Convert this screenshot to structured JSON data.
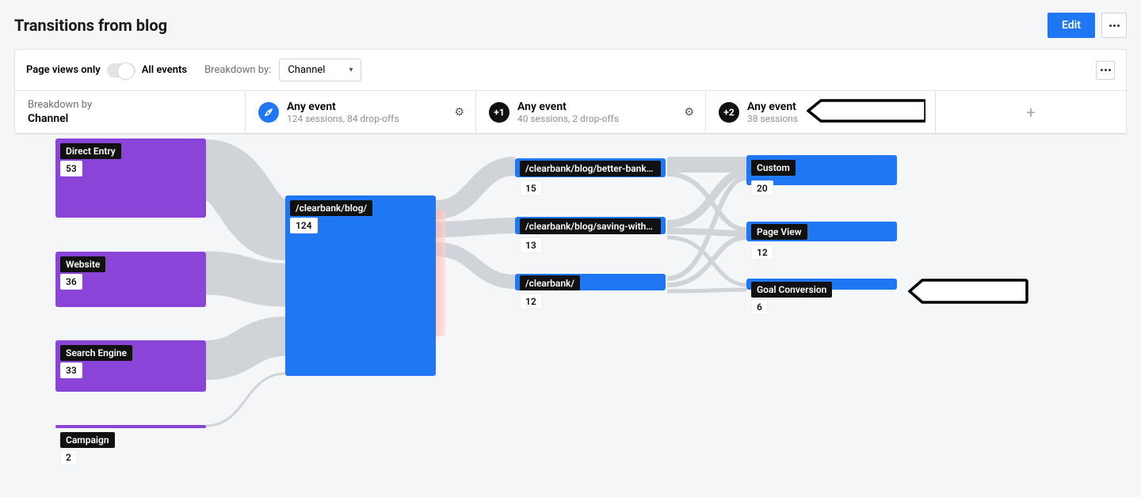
{
  "header": {
    "title": "Transitions from blog",
    "edit_label": "Edit"
  },
  "toolbar": {
    "views_only": "Page views only",
    "all_events": "All events",
    "breakdown_by_label": "Breakdown by:",
    "breakdown_value": "Channel"
  },
  "steps": {
    "breakdown_caption": "Breakdown by",
    "breakdown_value": "Channel",
    "s1": {
      "title": "Any event",
      "sub": "124 sessions, 84 drop-offs"
    },
    "s2": {
      "badge": "+1",
      "title": "Any event",
      "sub": "40 sessions, 2 drop-offs"
    },
    "s3": {
      "badge": "+2",
      "title": "Any event",
      "sub": "38 sessions"
    }
  },
  "nodes": {
    "direct": {
      "label": "Direct Entry",
      "count": "53"
    },
    "website": {
      "label": "Website",
      "count": "36"
    },
    "search": {
      "label": "Search Engine",
      "count": "33"
    },
    "campaign": {
      "label": "Campaign",
      "count": "2"
    },
    "blog": {
      "label": "/clearbank/blog/",
      "count": "124"
    },
    "p1": {
      "label": "/clearbank/blog/better-bankin...",
      "count": "15"
    },
    "p2": {
      "label": "/clearbank/blog/saving-with-c...",
      "count": "13"
    },
    "p3": {
      "label": "/clearbank/",
      "count": "12"
    },
    "custom": {
      "label": "Custom",
      "count": "20"
    },
    "pageview": {
      "label": "Page View",
      "count": "12"
    },
    "goal": {
      "label": "Goal Conversion",
      "count": "6"
    }
  },
  "chart_data": {
    "type": "sankey",
    "title": "Transitions from blog",
    "breakdown_by": "Channel",
    "stages": [
      {
        "name": "Channel",
        "nodes": [
          {
            "id": "direct",
            "label": "Direct Entry",
            "value": 53
          },
          {
            "id": "website",
            "label": "Website",
            "value": 36
          },
          {
            "id": "search",
            "label": "Search Engine",
            "value": 33
          },
          {
            "id": "campaign",
            "label": "Campaign",
            "value": 2
          }
        ]
      },
      {
        "name": "Any event (step 1)",
        "sessions": 124,
        "dropoffs": 84,
        "nodes": [
          {
            "id": "blog",
            "label": "/clearbank/blog/",
            "value": 124
          }
        ]
      },
      {
        "name": "Any event (step 2)",
        "sessions": 40,
        "dropoffs": 2,
        "nodes": [
          {
            "id": "p1",
            "label": "/clearbank/blog/better-bankin...",
            "value": 15
          },
          {
            "id": "p2",
            "label": "/clearbank/blog/saving-with-c...",
            "value": 13
          },
          {
            "id": "p3",
            "label": "/clearbank/",
            "value": 12
          }
        ]
      },
      {
        "name": "Any event (step 3)",
        "sessions": 38,
        "nodes": [
          {
            "id": "custom",
            "label": "Custom",
            "value": 20
          },
          {
            "id": "pageview",
            "label": "Page View",
            "value": 12
          },
          {
            "id": "goal",
            "label": "Goal Conversion",
            "value": 6
          }
        ]
      }
    ],
    "links": [
      {
        "source": "direct",
        "target": "blog",
        "value": 53
      },
      {
        "source": "website",
        "target": "blog",
        "value": 36
      },
      {
        "source": "search",
        "target": "blog",
        "value": 33
      },
      {
        "source": "campaign",
        "target": "blog",
        "value": 2
      },
      {
        "source": "blog",
        "target": "p1",
        "value": 15
      },
      {
        "source": "blog",
        "target": "p2",
        "value": 13
      },
      {
        "source": "blog",
        "target": "p3",
        "value": 12
      },
      {
        "source": "p1",
        "target": "custom",
        "value": 12
      },
      {
        "source": "p1",
        "target": "pageview",
        "value": 3
      },
      {
        "source": "p2",
        "target": "custom",
        "value": 5
      },
      {
        "source": "p2",
        "target": "pageview",
        "value": 5
      },
      {
        "source": "p2",
        "target": "goal",
        "value": 3
      },
      {
        "source": "p3",
        "target": "custom",
        "value": 3
      },
      {
        "source": "p3",
        "target": "pageview",
        "value": 4
      },
      {
        "source": "p3",
        "target": "goal",
        "value": 3
      }
    ]
  }
}
